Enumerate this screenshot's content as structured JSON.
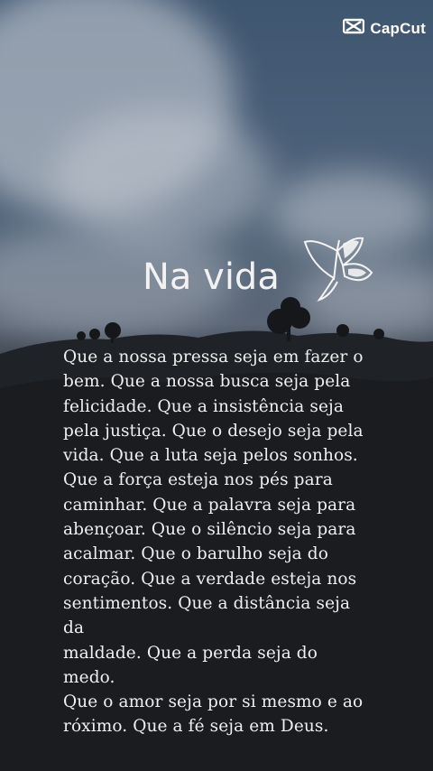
{
  "brand": {
    "name": "CapCut",
    "icon": "capcut-logo-icon"
  },
  "title": "Na vida",
  "decoration": {
    "icon": "butterfly-icon"
  },
  "poem_lines": [
    "Que a nossa pressa seja em fazer o",
    "bem. Que a nossa busca seja pela",
    "felicidade. Que a insistência seja",
    "pela justiça. Que o desejo seja pela",
    "vida. Que a luta seja pelos sonhos.",
    "Que a força esteja nos pés para",
    "caminhar. Que a palavra seja para",
    "abençoar. Que o silêncio seja para",
    "acalmar. Que o barulho seja do",
    "coração. Que a verdade esteja nos",
    "sentimentos. Que a distância seja",
    "da",
    "maldade. Que a perda seja do",
    "medo.",
    "Que o amor seja por si mesmo e ao",
    "róximo. Que a fé seja em Deus."
  ],
  "colors": {
    "text": "#efefef",
    "sky": "#4a5f78",
    "ground": "#1c1e21"
  }
}
